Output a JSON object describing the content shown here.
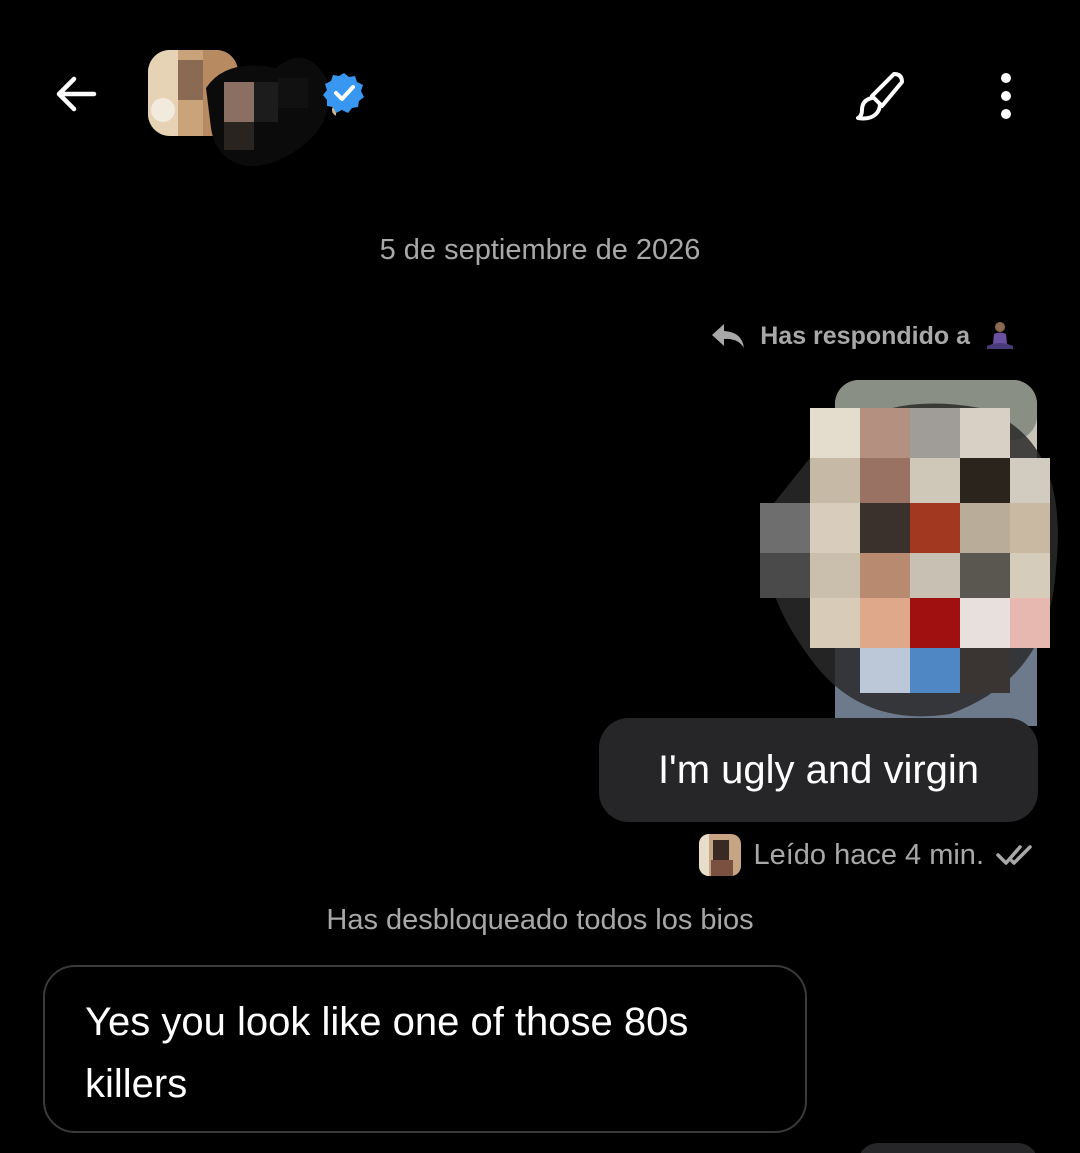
{
  "header": {
    "back_icon": "arrow-left-icon",
    "verified_icon": "verified-badge-icon",
    "theme_icon": "paintbrush-icon",
    "more_icon": "more-vertical-icon",
    "accent_color": "#3897f0"
  },
  "thread": {
    "date_divider": "5 de septiembre de 2026",
    "reply_note": "Has respondido a",
    "reply_icon": "reply-arrow-icon",
    "outgoing_message": "I'm ugly and virgin",
    "read_status": "Leído hace 4 min.",
    "read_icon": "double-check-icon",
    "system_note": "Has desbloqueado todos los bios",
    "incoming_message": "Yes you look like one of those 80s killers"
  },
  "colors": {
    "background": "#000000",
    "outgoing_bubble": "#262628",
    "incoming_border": "#3a3a3c",
    "muted_text": "#a8a8a8"
  }
}
